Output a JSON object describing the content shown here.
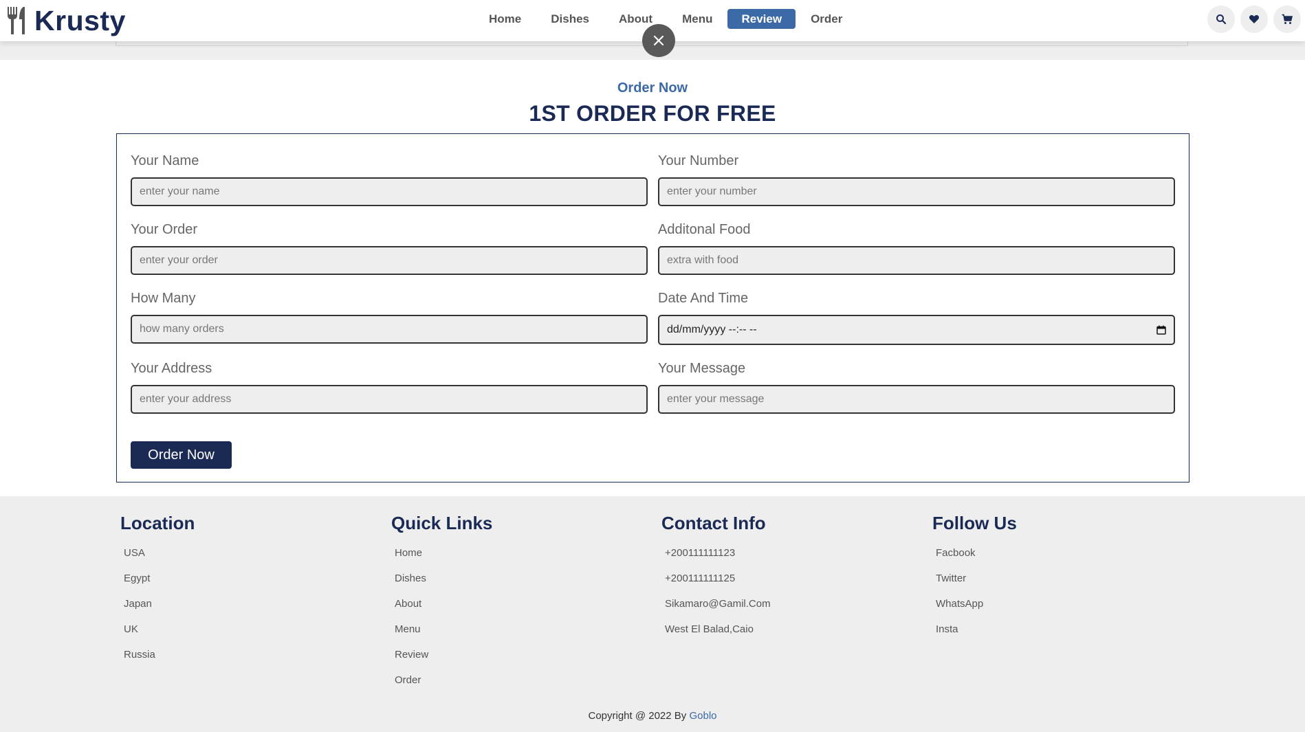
{
  "header": {
    "logo_text": "Krusty",
    "nav": [
      {
        "label": "Home",
        "active": false
      },
      {
        "label": "Dishes",
        "active": false
      },
      {
        "label": "About",
        "active": false
      },
      {
        "label": "Menu",
        "active": false
      },
      {
        "label": "Review",
        "active": true
      },
      {
        "label": "Order",
        "active": false
      }
    ],
    "icons": [
      "search-icon",
      "heart-icon",
      "cart-icon"
    ]
  },
  "order": {
    "subtitle": "Order Now",
    "title": "1ST ORDER FOR FREE",
    "fields": [
      {
        "label": "Your Name",
        "placeholder": "enter your name"
      },
      {
        "label": "Your Number",
        "placeholder": "enter your number"
      },
      {
        "label": "Your Order",
        "placeholder": "enter your order"
      },
      {
        "label": "Additonal Food",
        "placeholder": "extra with food"
      },
      {
        "label": "How Many",
        "placeholder": "how many orders"
      },
      {
        "label": "Date And Time",
        "placeholder": "dd/mm/yyyy --:-- --"
      },
      {
        "label": "Your Address",
        "placeholder": "enter your address"
      },
      {
        "label": "Your Message",
        "placeholder": "enter your message"
      }
    ],
    "submit_label": "Order Now"
  },
  "footer": {
    "columns": [
      {
        "title": "Location",
        "links": [
          "USA",
          "Egypt",
          "Japan",
          "UK",
          "Russia"
        ]
      },
      {
        "title": "Quick Links",
        "links": [
          "Home",
          "Dishes",
          "About",
          "Menu",
          "Review",
          "Order"
        ]
      },
      {
        "title": "Contact Info",
        "links": [
          "+200111111123",
          "+200111111125",
          "Sikamaro@Gamil.Com",
          "West El Balad,Caio"
        ]
      },
      {
        "title": "Follow Us",
        "links": [
          "Facbook",
          "Twitter",
          "WhatsApp",
          "Insta"
        ]
      }
    ],
    "copyright_prefix": "Copyright @ 2022 By",
    "copyright_author": "Goblo"
  },
  "colors": {
    "primary": "#1a2a55",
    "accent": "#3b6aa6",
    "background_gray": "#eeeeee"
  }
}
